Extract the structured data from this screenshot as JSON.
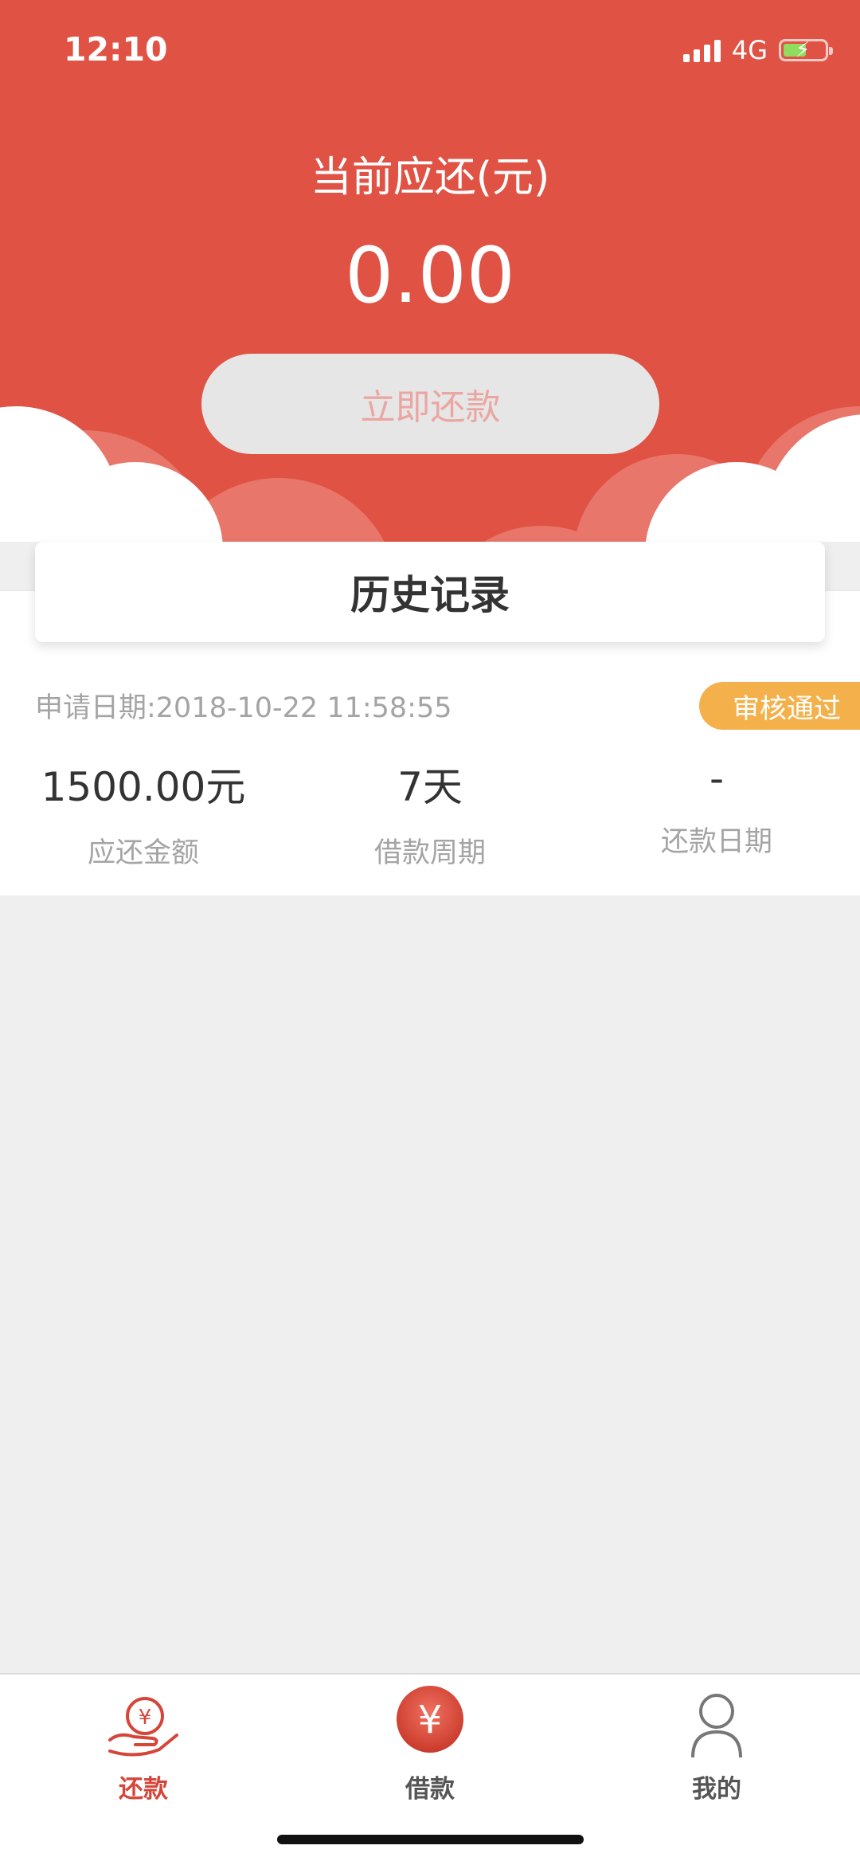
{
  "status_bar": {
    "time": "12:10",
    "network": "4G"
  },
  "header": {
    "title": "当前应还(元)",
    "amount": "0.00",
    "repay_button": "立即还款"
  },
  "history": {
    "title": "历史记录",
    "record": {
      "apply_date": "申请日期:2018-10-22 11:58:55",
      "status": "审核通过",
      "stats": [
        {
          "value": "1500.00元",
          "label": "应还金额"
        },
        {
          "value": "7天",
          "label": "借款周期"
        },
        {
          "value": "-",
          "label": "还款日期"
        }
      ]
    }
  },
  "tabbar": {
    "items": [
      {
        "label": "还款",
        "icon": "repay-hand-yen-icon",
        "active": true
      },
      {
        "label": "借款",
        "icon": "yen-coin-icon",
        "active": false
      },
      {
        "label": "我的",
        "icon": "user-icon",
        "active": false
      }
    ]
  },
  "colors": {
    "primary_red": "#e05244",
    "badge_orange": "#f4b14b",
    "active_tab": "#d6453a"
  }
}
